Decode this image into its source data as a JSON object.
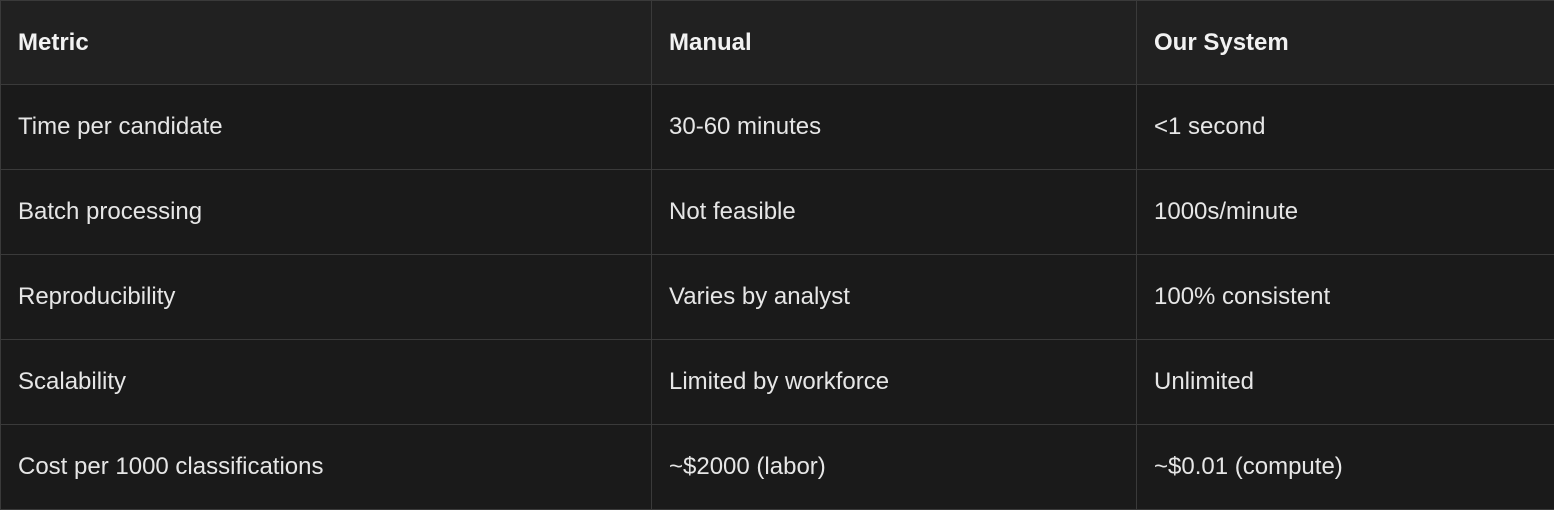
{
  "table": {
    "headers": [
      "Metric",
      "Manual",
      "Our System"
    ],
    "rows": [
      [
        "Time per candidate",
        "30-60 minutes",
        "<1 second"
      ],
      [
        "Batch processing",
        "Not feasible",
        "1000s/minute"
      ],
      [
        "Reproducibility",
        "Varies by analyst",
        "100% consistent"
      ],
      [
        "Scalability",
        "Limited by workforce",
        "Unlimited"
      ],
      [
        "Cost per 1000 classifications",
        "~$2000 (labor)",
        "~$0.01 (compute)"
      ]
    ]
  },
  "colors": {
    "background": "#1a1a1a",
    "header_background": "#212121",
    "border": "#3a3a3a",
    "text": "#e6e6e6"
  }
}
